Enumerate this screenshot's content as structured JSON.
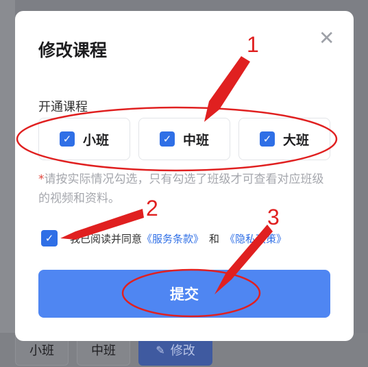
{
  "background": {
    "buttons": {
      "small": "小班",
      "mid": "中班",
      "edit": "修改"
    }
  },
  "modal": {
    "title": "修改课程",
    "section_label": "开通课程",
    "options": [
      {
        "label": "小班",
        "checked": true
      },
      {
        "label": "中班",
        "checked": true
      },
      {
        "label": "大班",
        "checked": true
      }
    ],
    "note_star": "*",
    "note": "请按实际情况勾选，只有勾选了班级才可查看对应班级的视频和资料。",
    "agree": {
      "checked": true,
      "prefix": "我已阅读并同意",
      "service_link": "《服务条款》",
      "and": "和",
      "privacy_link": "《隐私政策》"
    },
    "submit_label": "提交"
  },
  "annotations": {
    "numbers": [
      "1",
      "2",
      "3"
    ],
    "color": "#e02020"
  },
  "colors": {
    "accent": "#2f6fe6",
    "submit": "#4f86f2"
  }
}
